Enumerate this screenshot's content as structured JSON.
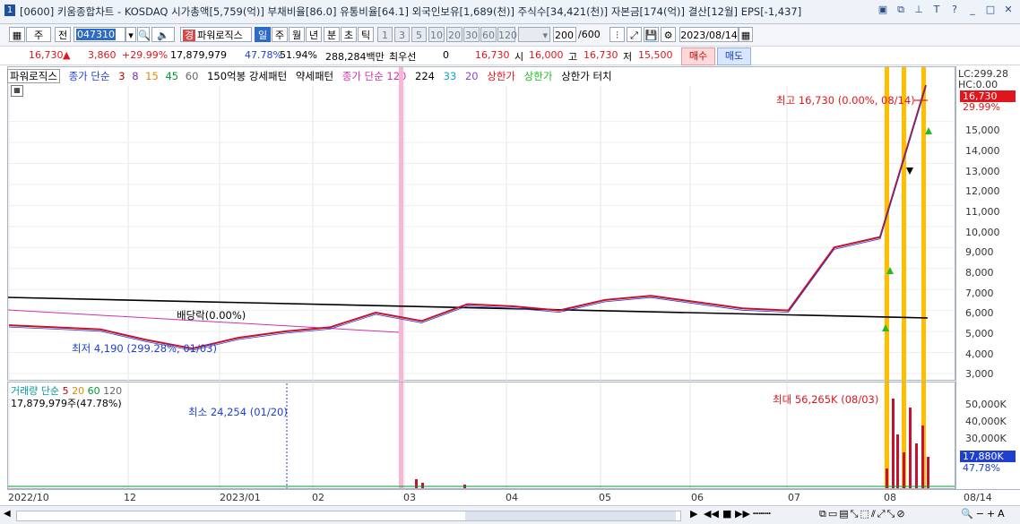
{
  "window": {
    "number": "1",
    "title": "[0600] 키움종합차트 - KOSDAQ 시가총액[5,759(억)] 부채비율[86.0] 유통비율[64.1] 외국인보유[1,689(천)] 주식수[34,421(천)] 자본금[174(억)] 결산[12월] EPS[-1,437]"
  },
  "toolbar": {
    "period_select": "주",
    "prev_button": "전",
    "stock_code": "047310",
    "indicator_label": "파워로직스",
    "period_tabs": [
      "일",
      "주",
      "월",
      "년",
      "분",
      "초",
      "틱"
    ],
    "active_tab": "일",
    "interval_buttons": [
      "1",
      "3",
      "5",
      "10",
      "20",
      "30",
      "60",
      "120"
    ],
    "count_value": "200",
    "count_max": "/600",
    "date_value": "2023/08/14"
  },
  "quote": {
    "price": "16,730",
    "change": "3,860",
    "change_pct": "+29.99%",
    "volume": "17,879,979",
    "vol_pct": "47.78%",
    "turnover_pct": "51.94%",
    "trade_value": "288,284백만",
    "preferred_label": "최우선",
    "preferred_value": "0",
    "last": "16,730",
    "open_label": "시",
    "open": "16,000",
    "high_label": "고",
    "high": "16,730",
    "low_label": "저",
    "low": "15,500",
    "buy_label": "매수",
    "sell_label": "매도"
  },
  "legend": {
    "name": "파워로직스",
    "ma_label": "종가 단순",
    "ma_periods": [
      "3",
      "8",
      "15",
      "45",
      "60"
    ],
    "pattern_strong": "150억봉 강세패턴",
    "pattern_weak": "약세패턴",
    "ma2_label": "종가 단순 120",
    "ma2_periods": [
      "224",
      "33",
      "20"
    ],
    "upper_limit": "상한가",
    "upper_limit2": "상한가",
    "upper_touch": "상한가 터치"
  },
  "annotations": {
    "high": "최고 16,730 (0.00%, 08/14)",
    "low": "최저 4,190 (299.28%, 01/03)",
    "dividend": "배당락(0.00%)",
    "vol_max": "최대 56,265K (08/03)",
    "vol_min": "최소 24,254 (01/20)"
  },
  "price_axis": {
    "lc": "LC:299.28",
    "hc": "HC:0.00",
    "last_badge": "16,730",
    "pct_badge": "29.99%",
    "ticks": [
      "15,000",
      "14,000",
      "13,000",
      "12,000",
      "11,000",
      "10,000",
      "9,000",
      "8,000",
      "7,000",
      "6,000",
      "5,000",
      "4,000",
      "3,000"
    ]
  },
  "volume_panel": {
    "label": "거래량 단순",
    "periods": [
      "5",
      "20",
      "60",
      "120"
    ],
    "current": "17,879,979주(47.78%)",
    "ticks": [
      "50,000K",
      "40,000K",
      "30,000K"
    ],
    "badge": "17,880K",
    "badge_pct": "47.78%"
  },
  "x_axis": {
    "labels": [
      "2022/10",
      "12",
      "2023/01",
      "02",
      "03",
      "04",
      "05",
      "06",
      "07",
      "08",
      "08/14"
    ]
  },
  "chart_data": {
    "type": "line",
    "title": "",
    "xlabel": "",
    "ylabel": "",
    "ylim": [
      3000,
      16730
    ],
    "series": [
      {
        "values": [
          5300,
          5200,
          5100,
          4600,
          4190,
          4700,
          5000,
          5200,
          5900,
          5500,
          6300,
          6200,
          6000,
          6500,
          6700,
          6400,
          6100,
          6000,
          9000,
          9500,
          16730
        ]
      }
    ]
  },
  "colors": {
    "up": "#e0161c",
    "down": "#1f3fd0",
    "highlight_bar": "#ffbf00",
    "pink_band": "#f7b6d4"
  }
}
